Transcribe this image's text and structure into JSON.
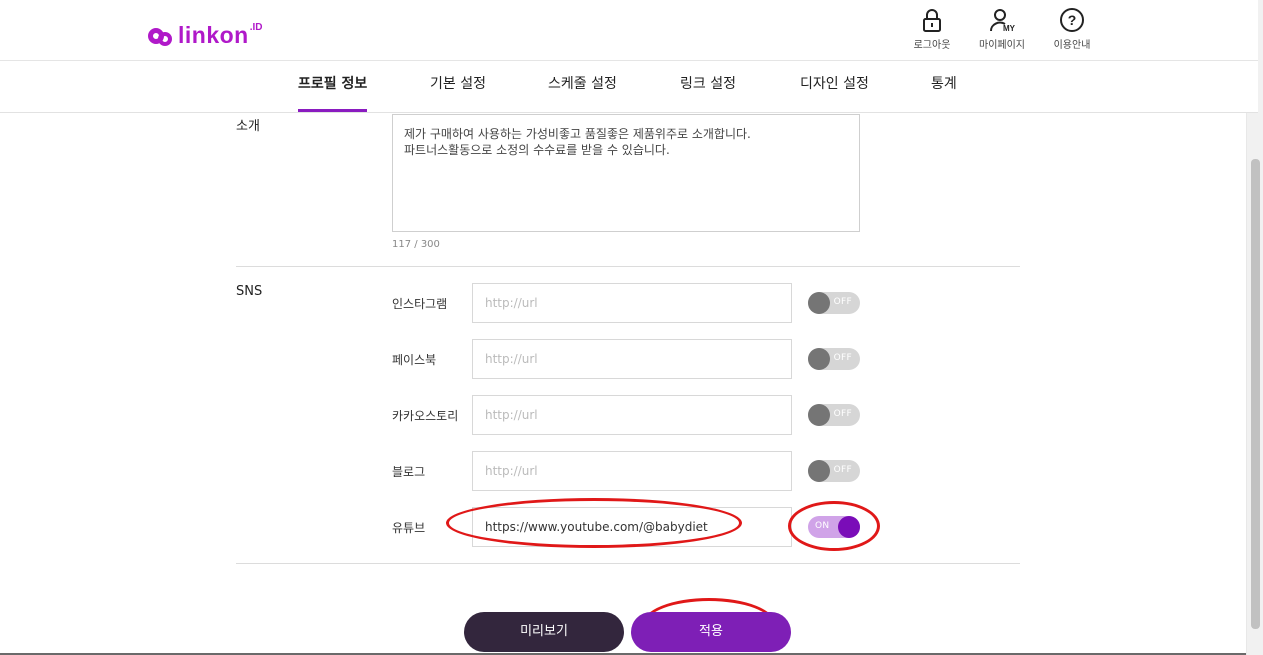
{
  "header": {
    "logo_text": "linkon",
    "logo_sup": ".ID",
    "buttons": [
      {
        "label": "로그아웃",
        "icon": "lock-icon"
      },
      {
        "label": "마이페이지",
        "icon": "user-my-icon"
      },
      {
        "label": "이용안내",
        "icon": "question-circle-icon"
      }
    ]
  },
  "tabs": [
    {
      "label": "프로필 정보",
      "active": true
    },
    {
      "label": "기본 설정",
      "active": false
    },
    {
      "label": "스케줄 설정",
      "active": false
    },
    {
      "label": "링크 설정",
      "active": false
    },
    {
      "label": "디자인 설정",
      "active": false
    },
    {
      "label": "통계",
      "active": false
    }
  ],
  "intro": {
    "label": "소개",
    "text": "제가 구매하여 사용하는 가성비좋고 품질좋은 제품위주로 소개합니다.\n파트너스활동으로 소정의 수수료를 받을 수 있습니다.",
    "counter": "117 / 300"
  },
  "sns": {
    "label": "SNS",
    "placeholder": "http://url",
    "rows": [
      {
        "name": "인스타그램",
        "value": "",
        "toggle": "OFF"
      },
      {
        "name": "페이스북",
        "value": "",
        "toggle": "OFF"
      },
      {
        "name": "카카오스토리",
        "value": "",
        "toggle": "OFF"
      },
      {
        "name": "블로그",
        "value": "",
        "toggle": "OFF"
      },
      {
        "name": "유튜브",
        "value": "https://www.youtube.com/@babydiet",
        "toggle": "ON"
      }
    ]
  },
  "actions": {
    "preview_label": "미리보기",
    "apply_label": "적용"
  },
  "colors": {
    "brand": "#b019c9",
    "apply": "#7e1fb6",
    "preview": "#33263d",
    "annotation": "#e01818"
  }
}
